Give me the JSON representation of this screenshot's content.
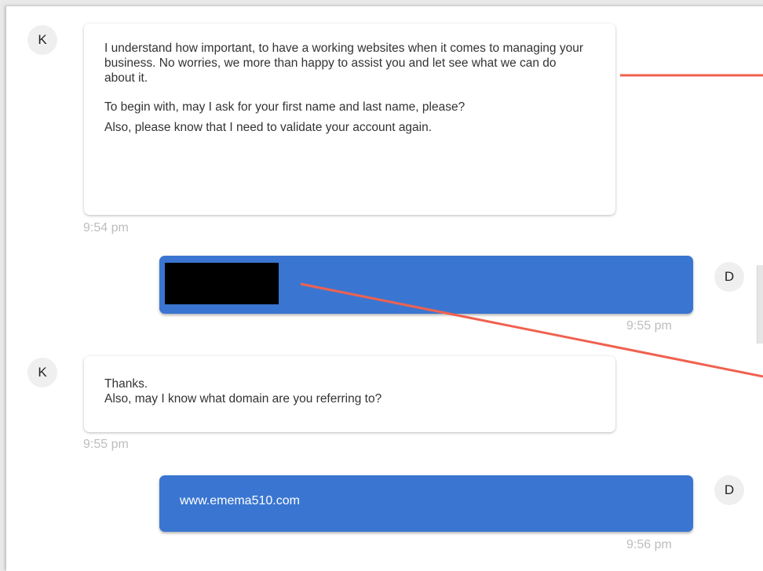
{
  "messages": [
    {
      "sender": "agent",
      "avatar": "K",
      "paragraphs": [
        "I understand how important, to have a working websites when it comes to managing your business. No worries, we more than happy to assist you and let see what we can do about it.",
        "To begin with, may I ask for your first name and last name, please?",
        "Also, please know that I need to validate your account again."
      ],
      "time": "9:54 pm"
    },
    {
      "sender": "user",
      "avatar": "D",
      "text": "",
      "redacted": true,
      "time": "9:55 pm"
    },
    {
      "sender": "agent",
      "avatar": "K",
      "lines": [
        "Thanks.",
        "Also, may I know what domain are you referring to?"
      ],
      "time": "9:55 pm"
    },
    {
      "sender": "user",
      "avatar": "D",
      "text": "www.emema510.com",
      "time": "9:56 pm"
    }
  ],
  "colors": {
    "user_bubble": "#3a76d1",
    "annotation_line": "#f0614f",
    "timestamp": "#bdbdbd"
  }
}
